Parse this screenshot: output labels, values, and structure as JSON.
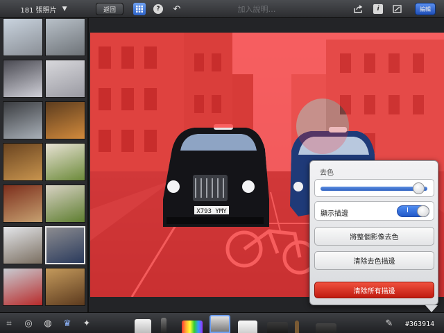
{
  "album": {
    "photo_count_label": "181 張照片",
    "dropdown_icon": "caret-down-icon"
  },
  "toolbar": {
    "back_label": "返回",
    "caption_placeholder": "加入說明…",
    "edit_label": "編輯",
    "help_glyph": "?",
    "info_glyph": "i"
  },
  "photo": {
    "license_plate": "X793 YMY"
  },
  "panel": {
    "title": "去色",
    "strength_value": 0.97,
    "show_edges_label": "顯示描邊",
    "show_edges_on": true,
    "toggle_on_label": "I",
    "desaturate_all_label": "將整個影像去色",
    "clear_desaturate_label": "清除去色描邊",
    "clear_all_label": "清除所有描邊"
  },
  "watermark": "#363914",
  "colors": {
    "accent_blue": "#2f62c2",
    "danger_red": "#d12a1b",
    "overlay_red": "#ff2b2b"
  },
  "thumbnails": [
    {
      "name": "thumb-london-skyline",
      "colors": [
        "#c9d3de",
        "#8a8f96"
      ]
    },
    {
      "name": "thumb-city-aerial",
      "colors": [
        "#b8c0c8",
        "#6e7378"
      ]
    },
    {
      "name": "thumb-owl-lens",
      "colors": [
        "#4a4a52",
        "#d0d0d8"
      ]
    },
    {
      "name": "thumb-cat-sticker",
      "colors": [
        "#d8d8dc",
        "#9a9aa2"
      ]
    },
    {
      "name": "thumb-mirror-car",
      "colors": [
        "#3a3c40",
        "#a9b0b8"
      ]
    },
    {
      "name": "thumb-wrap-food",
      "colors": [
        "#5c3c1e",
        "#d28a3c"
      ]
    },
    {
      "name": "thumb-wrap-plate",
      "colors": [
        "#6a4420",
        "#c8944e"
      ]
    },
    {
      "name": "thumb-salad-plate",
      "colors": [
        "#e8e2d4",
        "#6c8a3a"
      ]
    },
    {
      "name": "thumb-meat-dish",
      "colors": [
        "#7c2e1c",
        "#c6a070"
      ]
    },
    {
      "name": "thumb-salad-dish",
      "colors": [
        "#d8d2c4",
        "#5e7e30"
      ]
    },
    {
      "name": "thumb-building-facade",
      "colors": [
        "#e4e6ea",
        "#7a6e60"
      ]
    },
    {
      "name": "thumb-taxi-street",
      "colors": [
        "#8c8c90",
        "#2a3a5c"
      ]
    },
    {
      "name": "thumb-red-bicycle",
      "colors": [
        "#c8ccd2",
        "#b82a2a"
      ]
    },
    {
      "name": "thumb-cafe-interior",
      "colors": [
        "#c49a5c",
        "#5c3a1e"
      ]
    }
  ],
  "tools": [
    {
      "name": "crop-tool-icon",
      "glyph": "⌗"
    },
    {
      "name": "adjust-tool-icon",
      "glyph": "◎"
    },
    {
      "name": "color-tool-icon",
      "glyph": "◍"
    },
    {
      "name": "brush-tool-icon",
      "glyph": "♛"
    },
    {
      "name": "effects-tool-icon",
      "glyph": "✦"
    }
  ]
}
